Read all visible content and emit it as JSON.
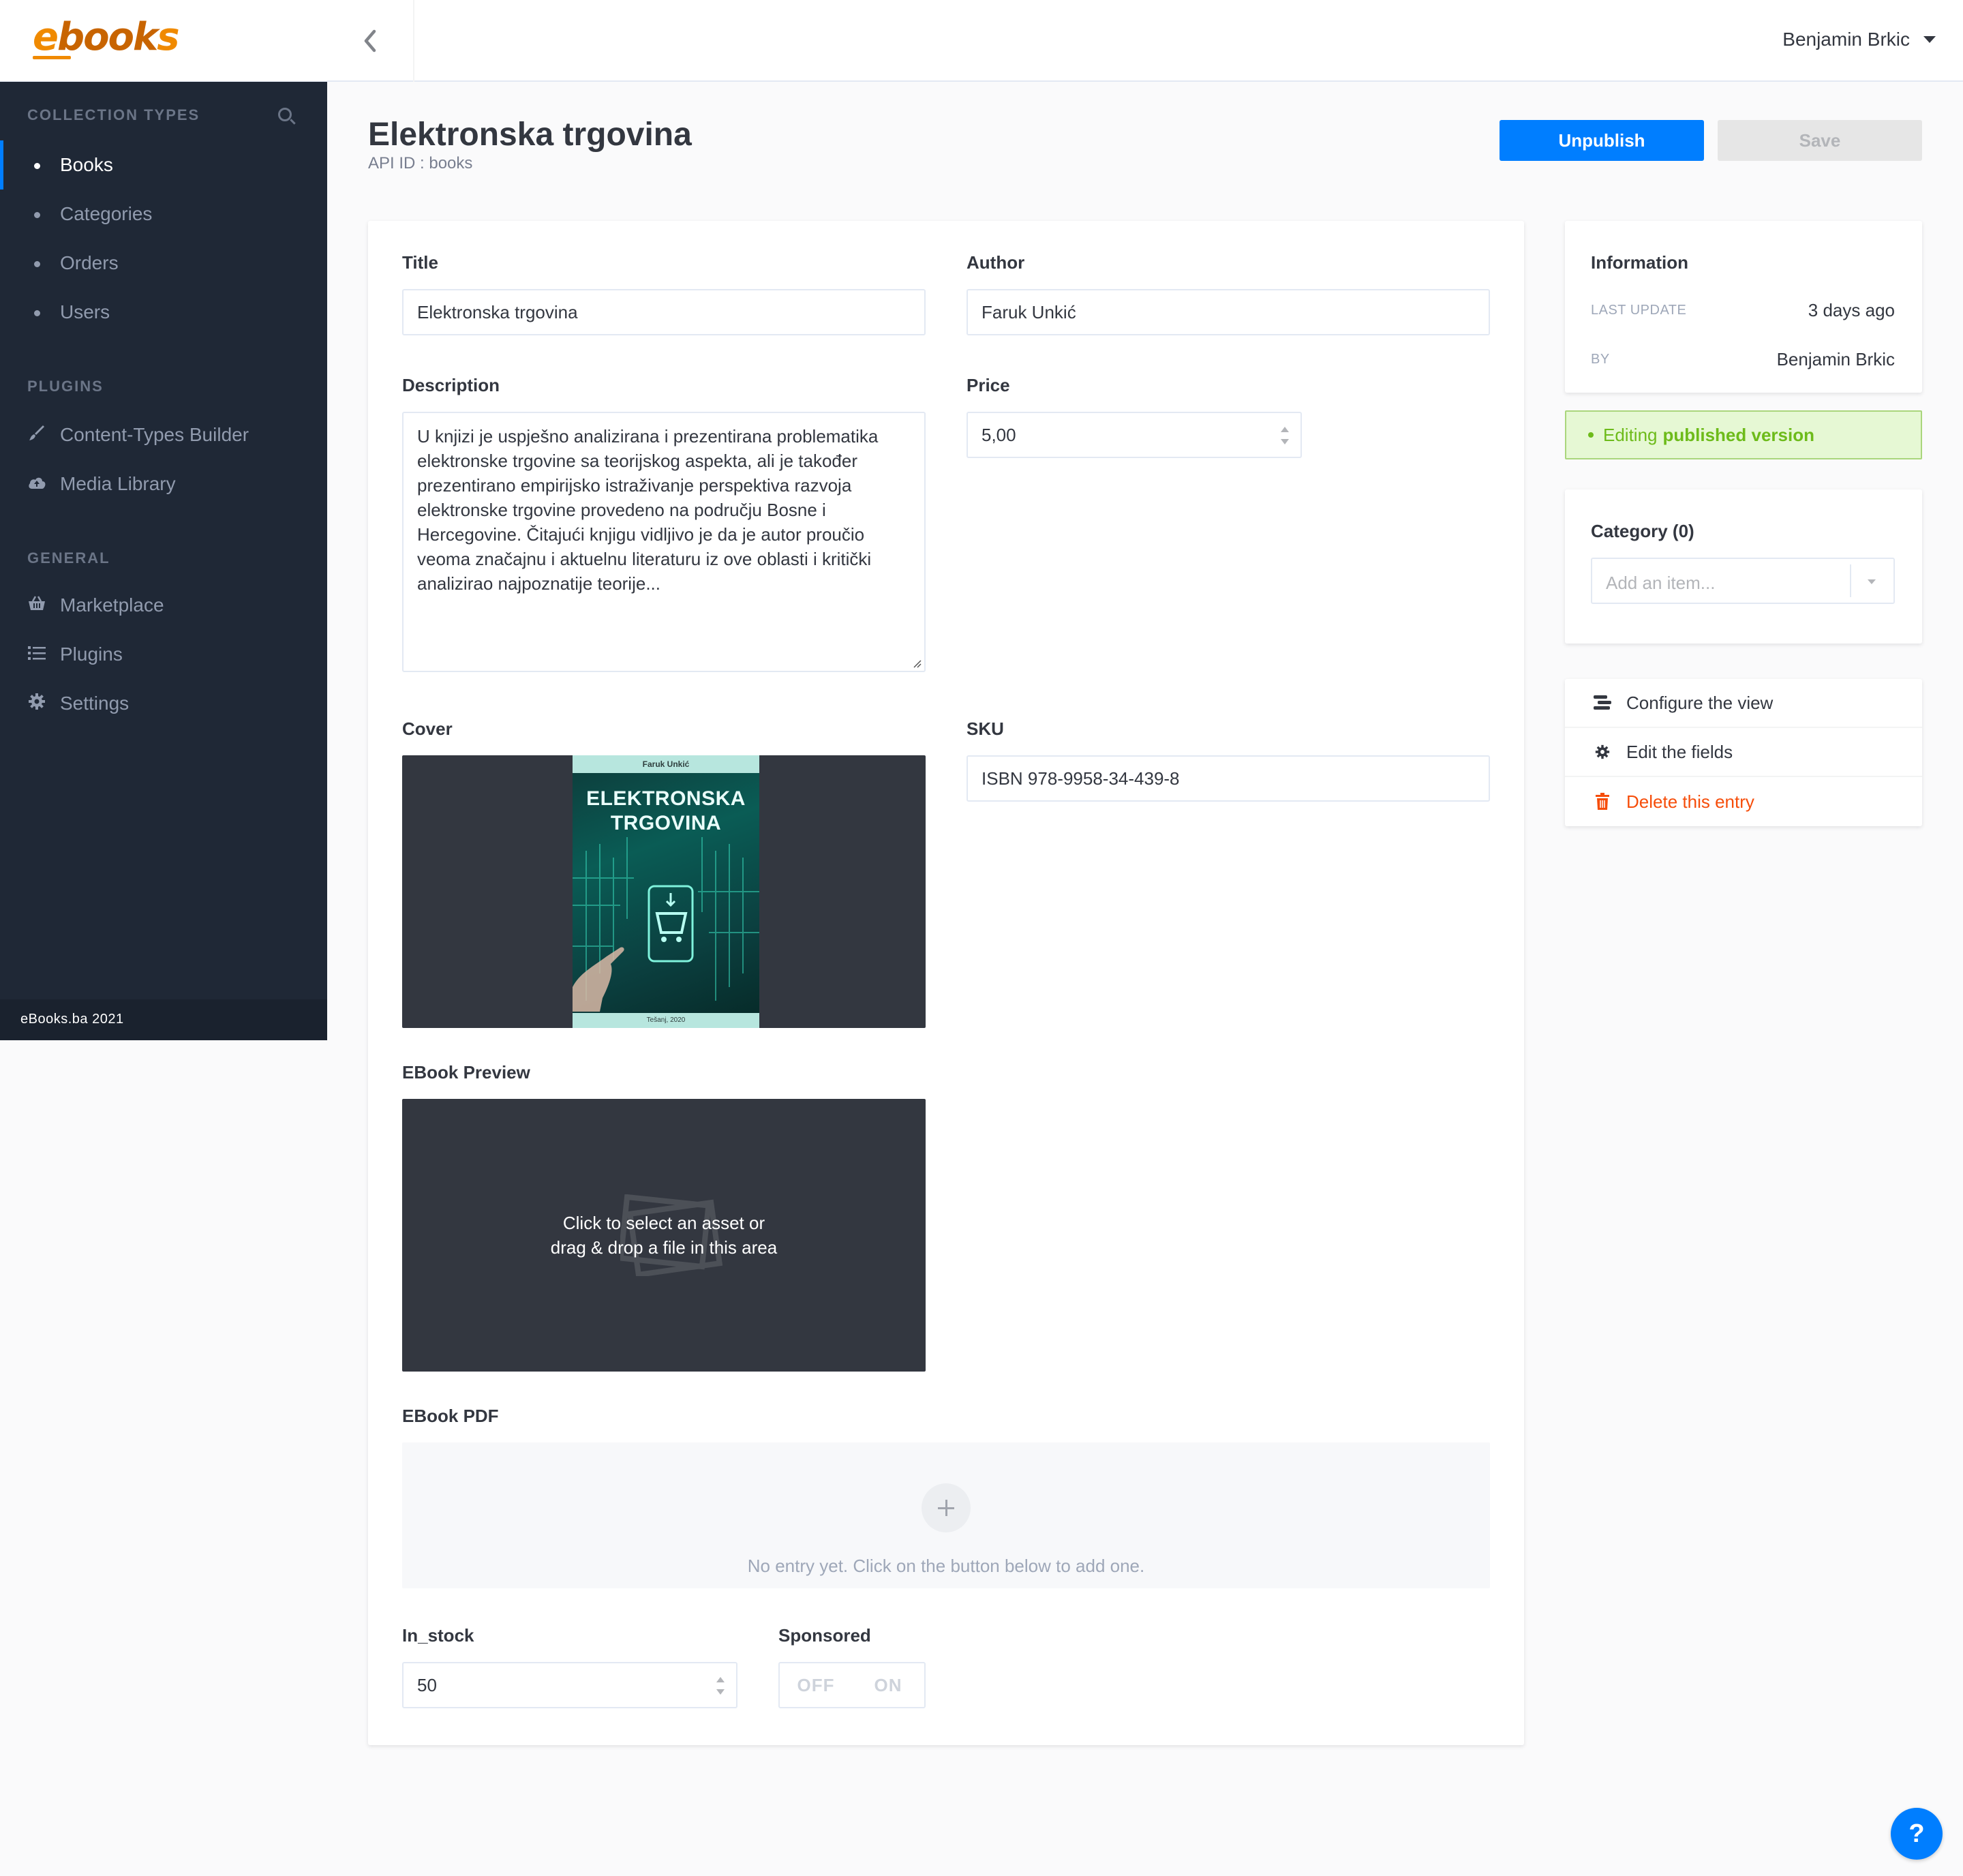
{
  "app": {
    "logo_text": "ebooks",
    "footer": "eBooks.ba 2021"
  },
  "sidebar": {
    "collection_types_title": "COLLECTION TYPES",
    "collection_items": [
      {
        "label": "Books"
      },
      {
        "label": "Categories"
      },
      {
        "label": "Orders"
      },
      {
        "label": "Users"
      }
    ],
    "plugins_title": "PLUGINS",
    "plugin_items": [
      {
        "label": "Content-Types Builder",
        "icon": "brush-icon"
      },
      {
        "label": "Media Library",
        "icon": "cloud-upload-icon"
      }
    ],
    "general_title": "GENERAL",
    "general_items": [
      {
        "label": "Marketplace",
        "icon": "basket-icon"
      },
      {
        "label": "Plugins",
        "icon": "list-icon"
      },
      {
        "label": "Settings",
        "icon": "gear-icon"
      }
    ]
  },
  "header": {
    "user_name": "Benjamin Brkic"
  },
  "page": {
    "title": "Elektronska trgovina",
    "api_id": "API ID : books",
    "unpublish_label": "Unpublish",
    "save_label": "Save"
  },
  "form": {
    "title_label": "Title",
    "title_value": "Elektronska trgovina",
    "author_label": "Author",
    "author_value": "Faruk Unkić",
    "description_label": "Description",
    "description_lines": [
      "U knjizi je uspješno analizirana i prezentirana problematika",
      "elektronske trgovine sa teorijskog aspekta, ali je također",
      "prezentirano empirijsko istraživanje perspektiva razvoja",
      "elektronske trgovine provedeno na području Bosne i",
      "Hercegovine. Čitajući knjigu vidljivo je da je autor proučio",
      "veoma značajnu i aktuelnu literaturu iz ove oblasti i kritički",
      "analizirao najpoznatije teorije..."
    ],
    "price_label": "Price",
    "price_value": "5,00",
    "cover_label": "Cover",
    "cover_book": {
      "author": "Faruk Unkić",
      "title_line1": "ELEKTRONSKA",
      "title_line2": "TRGOVINA",
      "footer": "Tešanj, 2020"
    },
    "sku_label": "SKU",
    "sku_value": "ISBN 978-9958-34-439-8",
    "ebook_preview_label": "EBook Preview",
    "drop_text_line1": "Click to select an asset or",
    "drop_text_line2": "drag & drop a file in this area",
    "ebook_pdf_label": "EBook PDF",
    "empty_relation_text": "No entry yet. Click on the button below to add one.",
    "in_stock_label": "In_stock",
    "in_stock_value": "50",
    "sponsored_label": "Sponsored",
    "toggle_off": "OFF",
    "toggle_on": "ON"
  },
  "info": {
    "title": "Information",
    "last_update_key": "LAST UPDATE",
    "last_update_value": "3 days ago",
    "by_key": "BY",
    "by_value": "Benjamin Brkic",
    "status_prefix": "Editing",
    "status_bold": "published version"
  },
  "category": {
    "title": "Category (0)",
    "placeholder": "Add an item..."
  },
  "actions": {
    "configure_view": "Configure the view",
    "edit_fields": "Edit the fields",
    "delete_entry": "Delete this entry"
  },
  "help": {
    "label": "?"
  },
  "colors": {
    "primary": "#007eff",
    "sidebar_bg": "#1f2836",
    "danger": "#f64d0a",
    "success": "#6dbb1a",
    "logo_orange": "#f08a00"
  }
}
